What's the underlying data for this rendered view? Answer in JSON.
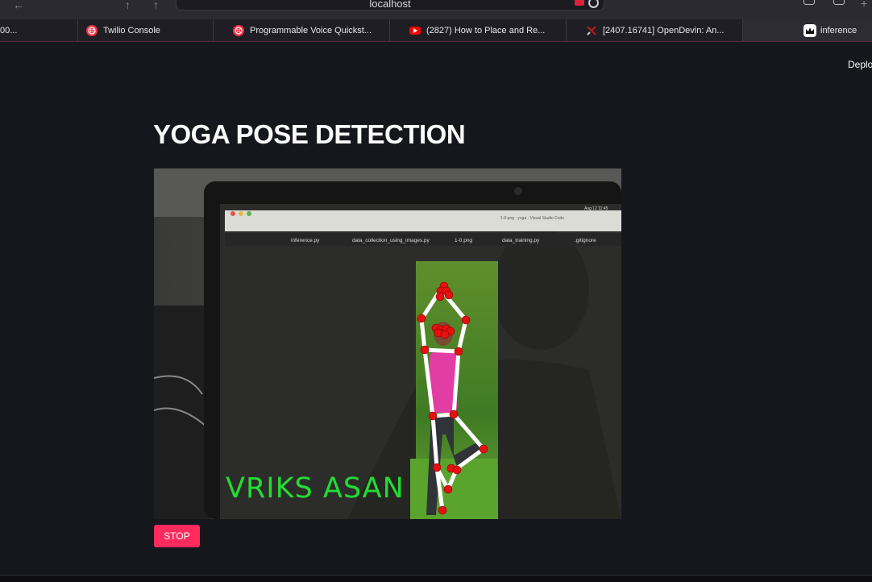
{
  "browser": {
    "url": "localhost",
    "tabs": [
      {
        "label": "00...",
        "icon": "generic-tab-icon"
      },
      {
        "label": "Twilio Console",
        "icon": "twilio-icon",
        "color": "#f22f46"
      },
      {
        "label": "Programmable Voice Quickst...",
        "icon": "twilio-icon",
        "color": "#f22f46"
      },
      {
        "label": "(2827) How to Place and Re...",
        "icon": "youtube-icon",
        "color": "#ff0000"
      },
      {
        "label": "[2407.16741] OpenDevin: An...",
        "icon": "arxiv-icon",
        "color": "#b31b1b"
      },
      {
        "label": "inference",
        "icon": "streamlit-crown-icon"
      }
    ]
  },
  "app": {
    "deploy_label": "Deploy",
    "title": "YOGA POSE DETECTION",
    "stop_label": "STOP"
  },
  "video": {
    "pose_label": "VRIKS ASAN",
    "pose_label_color": "#22dd33",
    "keypoint_color": "#e51010",
    "skeleton_color": "#ffffff",
    "screen_tabs": [
      "inference.py",
      "data_collection_using_images.py",
      "1-0.png",
      "data_training.py",
      ".gitignore"
    ],
    "screen_window_title": "1-0.png - yoga - Visual Studio Code",
    "screen_clock": "Aug 12 11:45"
  },
  "colors": {
    "background": "#16171c",
    "accent": "#ff2b5e"
  }
}
